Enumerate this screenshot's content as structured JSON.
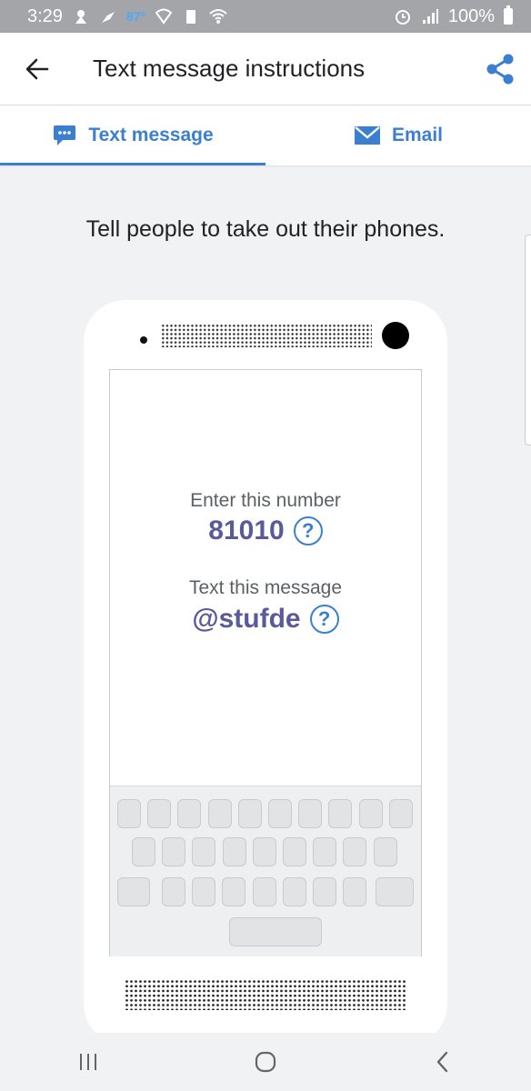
{
  "status_bar": {
    "time": "3:29",
    "temperature": "87°",
    "battery": "100%"
  },
  "app_bar": {
    "title": "Text message instructions"
  },
  "tabs": [
    {
      "label": "Text message",
      "active": true
    },
    {
      "label": "Email",
      "active": false
    }
  ],
  "instruction": "Tell people to take out their phones.",
  "phone_screen": {
    "number_label": "Enter this number",
    "number_value": "81010",
    "message_label": "Text this message",
    "message_value": "@stufde",
    "help_glyph": "?"
  },
  "colors": {
    "accent": "#3a7fd0",
    "value_text": "#5a5a9a",
    "status_bar": "#a3a5a8"
  },
  "icons": [
    "back-arrow-icon",
    "share-icon",
    "chat-bubble-icon",
    "envelope-icon",
    "help-icon",
    "recent-apps-icon",
    "home-icon",
    "nav-back-icon"
  ]
}
